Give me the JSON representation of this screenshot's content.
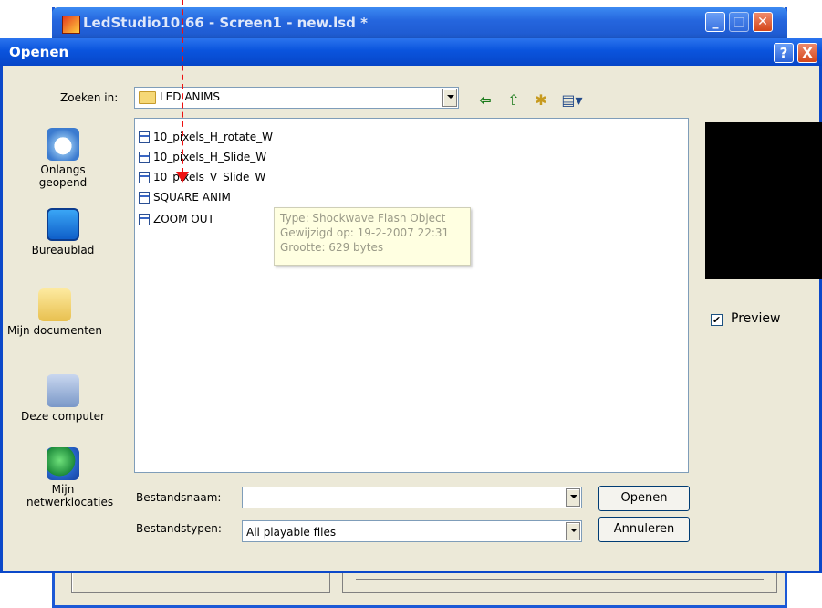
{
  "background_window": {
    "title": "LedStudio10.66 - Screen1 - new.lsd *",
    "minimize": "_",
    "maximize": "□",
    "close": "✕"
  },
  "dialog": {
    "title": "Openen",
    "help": "?",
    "close": "X",
    "look_in": {
      "label": "Zoeken in:",
      "value": "LED ANIMS"
    },
    "toolbar": {
      "back_icon": "⇦",
      "up_icon": "⇧",
      "new_folder_icon": "✱",
      "views_icon": "▤▾"
    },
    "places": [
      {
        "label": "Onlangs geopend",
        "icon": "recent-documents-icon"
      },
      {
        "label": "Bureaublad",
        "icon": "desktop-icon"
      },
      {
        "label": "Mijn documenten",
        "icon": "my-documents-icon"
      },
      {
        "label": "Deze computer",
        "icon": "my-computer-icon"
      },
      {
        "label": "Mijn netwerklocaties",
        "icon": "network-places-icon"
      }
    ],
    "files": [
      "10_pixels_H_rotate_W",
      "10_pixels_H_Slide_W",
      "10_pixels_V_Slide_W",
      "SQUARE ANIM",
      "ZOOM OUT"
    ],
    "tooltip": {
      "type": "Type: Shockwave Flash Object",
      "modified": "Gewijzigd op: 19-2-2007 22:31",
      "size": "Grootte: 629 bytes"
    },
    "preview_label": "Preview",
    "preview_checked": true,
    "filename": {
      "label": "Bestandsnaam:",
      "value": ""
    },
    "filetype": {
      "label": "Bestandstypen:",
      "value": "All playable files"
    },
    "open_button": "Openen",
    "cancel_button": "Annuleren"
  },
  "colors": {
    "annotation_arrow": "#ee1111",
    "titlebar_blue": "#0a54dd",
    "preview_background": "#000000"
  }
}
